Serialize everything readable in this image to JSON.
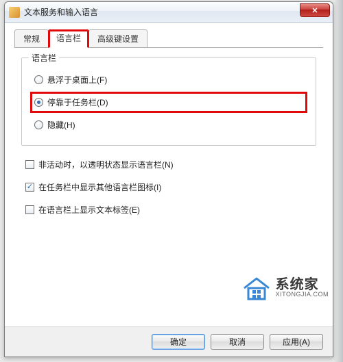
{
  "window": {
    "title": "文本服务和输入语言"
  },
  "tabs": {
    "general": "常规",
    "langbar": "语言栏",
    "advanced": "高级键设置"
  },
  "group": {
    "title": "语言栏",
    "radio_float": "悬浮于桌面上(F)",
    "radio_dock": "停靠于任务栏(D)",
    "radio_hide": "隐藏(H)"
  },
  "checks": {
    "transparent": "非活动时，以透明状态显示语言栏(N)",
    "show_icons": "在任务栏中显示其他语言栏图标(I)",
    "show_text": "在语言栏上显示文本标签(E)"
  },
  "buttons": {
    "ok": "确定",
    "cancel": "取消",
    "apply": "应用(A)"
  },
  "watermark": {
    "cn": "系统家",
    "en": "XITONGJIA.COM"
  }
}
